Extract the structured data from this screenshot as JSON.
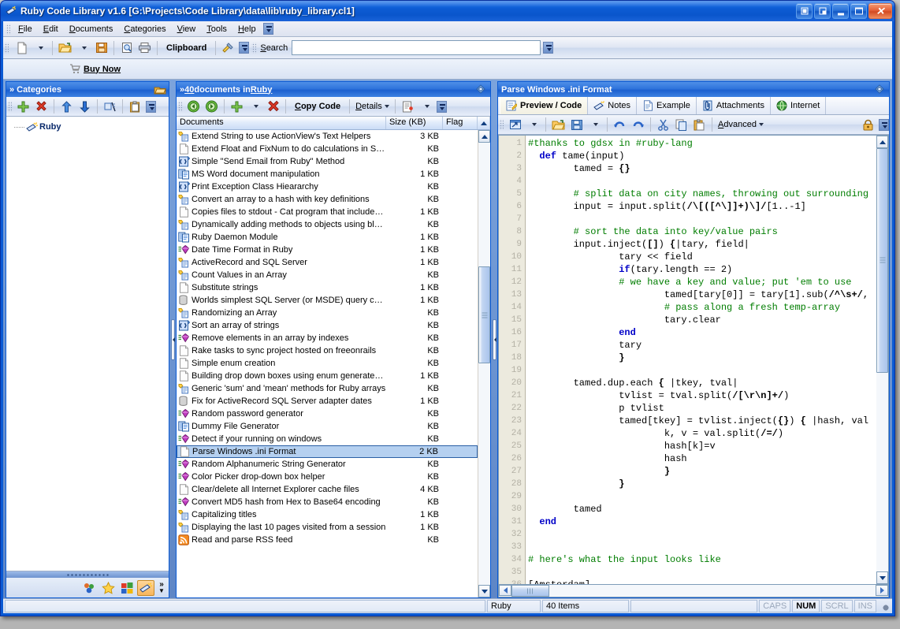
{
  "window": {
    "title": "Ruby Code Library v1.6 [G:\\Projects\\Code Library\\data\\lib\\ruby_library.cl1]",
    "buttons": {
      "restore_doc": "restore-document",
      "restore_window": "restore-window",
      "minimize": "_",
      "maximize": "maximize",
      "close": "×"
    }
  },
  "menubar": {
    "items": [
      {
        "label": "File"
      },
      {
        "label": "Edit"
      },
      {
        "label": "Documents"
      },
      {
        "label": "Categories"
      },
      {
        "label": "View"
      },
      {
        "label": "Tools"
      },
      {
        "label": "Help"
      }
    ]
  },
  "toolbar": {
    "new_label": "new-document",
    "open_label": "open",
    "save_label": "save",
    "preview_label": "print-preview",
    "print_label": "print",
    "clipboard_label": "Clipboard",
    "tools_label": "tools"
  },
  "search": {
    "label": "Search",
    "value": "",
    "placeholder": ""
  },
  "buy": {
    "label": "Buy Now"
  },
  "categories": {
    "header": "Categories",
    "chevron": "»",
    "toolbar": [
      {
        "name": "add-category"
      },
      {
        "name": "delete-category"
      },
      {
        "name": "move-up"
      },
      {
        "name": "move-down"
      },
      {
        "name": "rename-category"
      },
      {
        "name": "paste-category"
      }
    ],
    "tree": [
      {
        "label": "Ruby",
        "selected": true
      }
    ],
    "footer_icons": [
      {
        "name": "contacts-icon"
      },
      {
        "name": "favorites-icon"
      },
      {
        "name": "windows-icon"
      },
      {
        "name": "ruby-icon",
        "active": true
      }
    ],
    "footer_more": "»"
  },
  "documents": {
    "header_prefix": "» ",
    "header_count": "40",
    "header_mid": " documents in ",
    "header_cat": "Ruby",
    "toolbar": {
      "back": "back",
      "forward": "forward",
      "add": "add-document",
      "delete": "delete-document",
      "copy_code": "Copy Code",
      "details": "Details",
      "properties": "properties"
    },
    "columns": [
      "Documents",
      "Size (KB)",
      "Flag"
    ],
    "rows": [
      {
        "icon": "gold-doc-icon",
        "name": "Extend String to use ActionView's Text Helpers",
        "size": "3 KB",
        "flag": ""
      },
      {
        "icon": "blank-doc-icon",
        "name": "Extend Float and FixNum to do calculations in S…",
        "size": "KB",
        "flag": ""
      },
      {
        "icon": "code-doc-icon",
        "name": "Simple \"Send Email from Ruby\" Method",
        "size": "KB",
        "flag": ""
      },
      {
        "icon": "pages-icon",
        "name": "MS Word document manipulation",
        "size": "1 KB",
        "flag": ""
      },
      {
        "icon": "code-doc-icon",
        "name": "Print Exception Class Hieararchy",
        "size": "KB",
        "flag": ""
      },
      {
        "icon": "gold-doc-icon",
        "name": "Convert an array to a hash with key definitions",
        "size": "KB",
        "flag": ""
      },
      {
        "icon": "blank-doc-icon",
        "name": "Copies files to stdout - Cat program that include…",
        "size": "1 KB",
        "flag": ""
      },
      {
        "icon": "gold-doc-icon",
        "name": "Dynamically adding methods to objects using blo…",
        "size": "KB",
        "flag": ""
      },
      {
        "icon": "pages-icon",
        "name": "Ruby Daemon Module",
        "size": "1 KB",
        "flag": ""
      },
      {
        "icon": "gem-icon",
        "name": "Date Time Format in Ruby",
        "size": "1 KB",
        "flag": ""
      },
      {
        "icon": "gold-doc-icon",
        "name": "ActiveRecord and SQL Server",
        "size": "1 KB",
        "flag": ""
      },
      {
        "icon": "gold-doc-icon",
        "name": "Count Values in an Array",
        "size": "KB",
        "flag": ""
      },
      {
        "icon": "blank-doc-icon",
        "name": "Substitute strings",
        "size": "1 KB",
        "flag": ""
      },
      {
        "icon": "cylinder-icon",
        "name": "Worlds simplest SQL Server (or MSDE) query code",
        "size": "1 KB",
        "flag": ""
      },
      {
        "icon": "gold-doc-icon",
        "name": "Randomizing an Array",
        "size": "KB",
        "flag": ""
      },
      {
        "icon": "code-doc-icon",
        "name": "Sort an array of strings",
        "size": "KB",
        "flag": ""
      },
      {
        "icon": "gem-icon",
        "name": "Remove elements in an array by indexes",
        "size": "KB",
        "flag": ""
      },
      {
        "icon": "blank-doc-icon",
        "name": "Rake tasks to sync project hosted on freeonrails",
        "size": "KB",
        "flag": ""
      },
      {
        "icon": "blank-doc-icon",
        "name": "Simple enum creation",
        "size": "KB",
        "flag": ""
      },
      {
        "icon": "blank-doc-icon",
        "name": "Building drop down boxes using enum generate…",
        "size": "1 KB",
        "flag": ""
      },
      {
        "icon": "gold-doc-icon",
        "name": "Generic 'sum' and 'mean' methods for Ruby arrays",
        "size": "KB",
        "flag": ""
      },
      {
        "icon": "cylinder-icon",
        "name": "Fix for ActiveRecord SQL Server adapter dates",
        "size": "1 KB",
        "flag": ""
      },
      {
        "icon": "gem-icon",
        "name": "Random password generator",
        "size": "KB",
        "flag": ""
      },
      {
        "icon": "pages-icon",
        "name": "Dummy File Generator",
        "size": "KB",
        "flag": ""
      },
      {
        "icon": "gem-icon",
        "name": "Detect if your running on windows",
        "size": "KB",
        "flag": ""
      },
      {
        "icon": "blank-doc-icon",
        "name": "Parse Windows .ini Format",
        "size": "2 KB",
        "flag": "",
        "selected": true
      },
      {
        "icon": "gem-icon",
        "name": "Random Alphanumeric String Generator",
        "size": "KB",
        "flag": ""
      },
      {
        "icon": "gem-icon",
        "name": "Color Picker drop-down box helper",
        "size": "KB",
        "flag": ""
      },
      {
        "icon": "blank-doc-icon",
        "name": "Clear/delete all Internet Explorer cache files",
        "size": "4 KB",
        "flag": ""
      },
      {
        "icon": "gem-icon",
        "name": "Convert MD5 hash from Hex to Base64 encoding",
        "size": "KB",
        "flag": ""
      },
      {
        "icon": "gold-doc-icon",
        "name": "Capitalizing titles",
        "size": "1 KB",
        "flag": ""
      },
      {
        "icon": "gold-doc-icon",
        "name": "Displaying the last 10 pages visited from a session",
        "size": "1 KB",
        "flag": ""
      },
      {
        "icon": "rss-icon",
        "name": "Read and parse RSS feed",
        "size": "KB",
        "flag": ""
      }
    ]
  },
  "preview": {
    "header": "Parse Windows .ini Format",
    "tabs": [
      {
        "label": "Preview / Code",
        "icon": "preview-code-icon",
        "active": true
      },
      {
        "label": "Notes",
        "icon": "notes-icon",
        "active": false
      },
      {
        "label": "Example",
        "icon": "example-icon",
        "active": false
      },
      {
        "label": "Attachments",
        "icon": "attachments-icon",
        "active": false
      },
      {
        "label": "Internet",
        "icon": "internet-icon",
        "active": false
      }
    ],
    "toolbar": {
      "open_external": "open-external",
      "open": "open-file",
      "save": "save-file",
      "undo": "undo",
      "redo": "redo",
      "cut": "cut",
      "copy": "copy",
      "paste": "paste",
      "advanced": "Advanced",
      "lock": "lock"
    },
    "code_lines": [
      {
        "n": 1,
        "segments": [
          {
            "t": "#thanks to gdsx in #ruby-lang",
            "c": "cmt"
          }
        ]
      },
      {
        "n": 2,
        "segments": [
          {
            "t": "  "
          },
          {
            "t": "def",
            "c": "kw"
          },
          {
            "t": " tame(input)"
          }
        ]
      },
      {
        "n": 3,
        "segments": [
          {
            "t": "        tamed = "
          },
          {
            "t": "{}",
            "c": "re"
          }
        ]
      },
      {
        "n": 4,
        "segments": [
          {
            "t": ""
          }
        ]
      },
      {
        "n": 5,
        "segments": [
          {
            "t": "        # split data on city names, throwing out surrounding",
            "c": "cmt"
          }
        ]
      },
      {
        "n": 6,
        "segments": [
          {
            "t": "        input = input.split("
          },
          {
            "t": "/\\[([^\\]]+)\\]/",
            "c": "re"
          },
          {
            "t": "[1..-1]"
          }
        ]
      },
      {
        "n": 7,
        "segments": [
          {
            "t": ""
          }
        ]
      },
      {
        "n": 8,
        "segments": [
          {
            "t": "        # sort the data into key/value pairs",
            "c": "cmt"
          }
        ]
      },
      {
        "n": 9,
        "segments": [
          {
            "t": "        input.inject("
          },
          {
            "t": "[]",
            "c": "re"
          },
          {
            "t": ") "
          },
          {
            "t": "{",
            "c": "re"
          },
          {
            "t": "|tary, field|"
          }
        ]
      },
      {
        "n": 10,
        "segments": [
          {
            "t": "                tary << field"
          }
        ]
      },
      {
        "n": 11,
        "segments": [
          {
            "t": "                "
          },
          {
            "t": "if",
            "c": "kw"
          },
          {
            "t": "(tary.length == 2)"
          }
        ]
      },
      {
        "n": 12,
        "segments": [
          {
            "t": "                # we have a key and value; put 'em to use",
            "c": "cmt"
          }
        ]
      },
      {
        "n": 13,
        "segments": [
          {
            "t": "                        tamed[tary[0]] = tary[1].sub("
          },
          {
            "t": "/^\\s+/",
            "c": "re"
          },
          {
            "t": ","
          }
        ]
      },
      {
        "n": 14,
        "segments": [
          {
            "t": "                        # pass along a fresh temp-array",
            "c": "cmt"
          }
        ]
      },
      {
        "n": 15,
        "segments": [
          {
            "t": "                        tary.clear"
          }
        ]
      },
      {
        "n": 16,
        "segments": [
          {
            "t": "                "
          },
          {
            "t": "end",
            "c": "kw"
          }
        ]
      },
      {
        "n": 17,
        "segments": [
          {
            "t": "                tary"
          }
        ]
      },
      {
        "n": 18,
        "segments": [
          {
            "t": "                "
          },
          {
            "t": "}",
            "c": "re"
          }
        ]
      },
      {
        "n": 19,
        "segments": [
          {
            "t": ""
          }
        ]
      },
      {
        "n": 20,
        "segments": [
          {
            "t": "        tamed.dup.each "
          },
          {
            "t": "{",
            "c": "re"
          },
          {
            "t": " |tkey, tval|"
          }
        ]
      },
      {
        "n": 21,
        "segments": [
          {
            "t": "                tvlist = tval.split("
          },
          {
            "t": "/[\\r\\n]+/",
            "c": "re"
          },
          {
            "t": ")"
          }
        ]
      },
      {
        "n": 22,
        "segments": [
          {
            "t": "                p tvlist"
          }
        ]
      },
      {
        "n": 23,
        "segments": [
          {
            "t": "                tamed[tkey] = tvlist.inject("
          },
          {
            "t": "{}",
            "c": "re"
          },
          {
            "t": ") "
          },
          {
            "t": "{",
            "c": "re"
          },
          {
            "t": " |hash, val"
          }
        ]
      },
      {
        "n": 24,
        "segments": [
          {
            "t": "                        k, v = val.split("
          },
          {
            "t": "/=/",
            "c": "re"
          },
          {
            "t": ")"
          }
        ]
      },
      {
        "n": 25,
        "segments": [
          {
            "t": "                        hash[k]=v"
          }
        ]
      },
      {
        "n": 26,
        "segments": [
          {
            "t": "                        hash"
          }
        ]
      },
      {
        "n": 27,
        "segments": [
          {
            "t": "                        "
          },
          {
            "t": "}",
            "c": "re"
          }
        ]
      },
      {
        "n": 28,
        "segments": [
          {
            "t": "                "
          },
          {
            "t": "}",
            "c": "re"
          }
        ]
      },
      {
        "n": 29,
        "segments": [
          {
            "t": ""
          }
        ]
      },
      {
        "n": 30,
        "segments": [
          {
            "t": "        tamed"
          }
        ]
      },
      {
        "n": 31,
        "segments": [
          {
            "t": "  "
          },
          {
            "t": "end",
            "c": "kw"
          }
        ]
      },
      {
        "n": 32,
        "segments": [
          {
            "t": ""
          }
        ]
      },
      {
        "n": 33,
        "segments": [
          {
            "t": ""
          }
        ]
      },
      {
        "n": 34,
        "segments": [
          {
            "t": "# here's what the input looks like",
            "c": "cmt"
          }
        ]
      },
      {
        "n": 35,
        "segments": [
          {
            "t": ""
          }
        ]
      },
      {
        "n": 36,
        "segments": [
          {
            "t": "[Amsterdam]"
          }
        ]
      }
    ]
  },
  "statusbar": {
    "panel1": "",
    "category": "Ruby",
    "items": "40 Items",
    "panel4": "",
    "caps": "CAPS",
    "num": "NUM",
    "scrl": "SCRL",
    "ins": "INS"
  },
  "colors": {
    "title_blue": "#0a5ad4",
    "pane_header": "#2f74dc",
    "selection": "#b5d0f0",
    "comment_green": "#007d00",
    "keyword_blue": "#0000c8"
  }
}
